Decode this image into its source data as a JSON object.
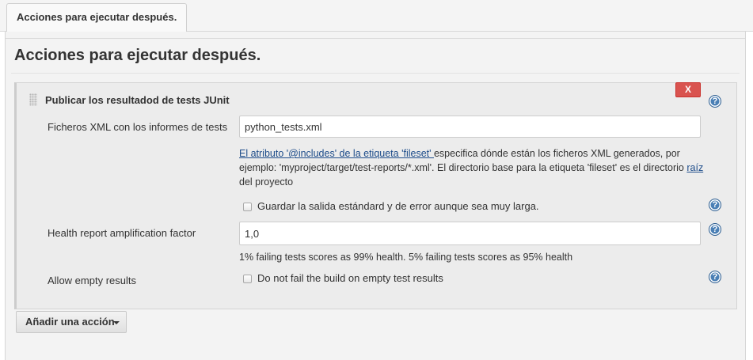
{
  "tab": {
    "label": "Acciones para ejecutar después."
  },
  "section": {
    "title": "Acciones para ejecutar después."
  },
  "block": {
    "title": "Publicar los resultadod de tests JUnit",
    "close_label": "X",
    "help_glyph": "?",
    "xml_label": "Ficheros XML con los informes de tests",
    "xml_value": "python_tests.xml",
    "help_link_text": "El atributo '@includes' de la etiqueta 'fileset' ",
    "help_body_1": "especifica dónde están los ficheros XML generados, por ejemplo: 'myproject/target/test-reports/*.xml'. El directorio base para la etiqueta 'fileset' es el directorio ",
    "help_link_2": "raíz",
    "help_body_2": " del proyecto",
    "keep_output_label": "Guardar la salida estándard y de error aunque sea muy larga.",
    "health_label": "Health report amplification factor",
    "health_value": "1,0",
    "health_help": "1% failing tests scores as 99% health. 5% failing tests scores as 95% health",
    "allow_empty_label": "Allow empty results",
    "allow_empty_checkbox_label": "Do not fail the build on empty test results"
  },
  "add_action": {
    "label": "Añadir una acción"
  },
  "icons": {
    "help": "help-circle-icon",
    "drag": "drag-handle-icon",
    "close": "close-icon",
    "caret": "caret-down-icon"
  },
  "colors": {
    "close_red": "#d9534f",
    "help_blue": "#4a7fb5",
    "link_blue": "#1d4c8a"
  }
}
